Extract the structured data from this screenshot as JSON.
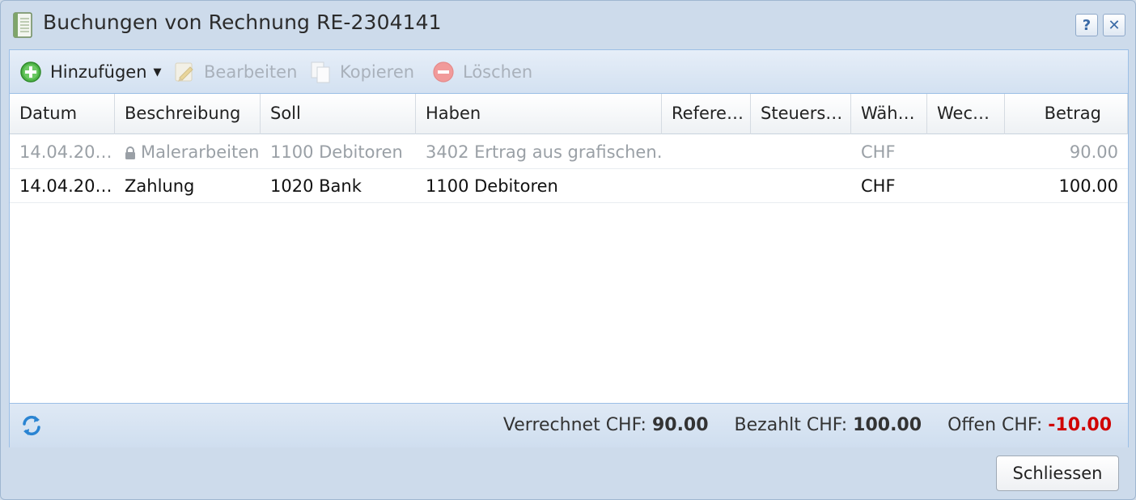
{
  "window": {
    "title": "Buchungen von Rechnung RE-2304141",
    "help_label": "?",
    "close_label": "✕"
  },
  "toolbar": {
    "add_label": "Hinzufügen",
    "edit_label": "Bearbeiten",
    "copy_label": "Kopieren",
    "delete_label": "Löschen"
  },
  "grid": {
    "columns": [
      "Datum",
      "Beschreibung",
      "Soll",
      "Haben",
      "Refere…",
      "Steuers…",
      "Wäh…",
      "Wec…",
      "Betrag"
    ],
    "rows": [
      {
        "locked": true,
        "datum": "14.04.20…",
        "beschreibung": "Malerarbeiten",
        "soll": "1100 Debitoren",
        "haben": "3402 Ertrag aus grafischen…",
        "referenz": "",
        "steuersatz": "",
        "waehrung": "CHF",
        "wechselkurs": "",
        "betrag": "90.00"
      },
      {
        "locked": false,
        "datum": "14.04.20…",
        "beschreibung": "Zahlung",
        "soll": "1020 Bank",
        "haben": "1100 Debitoren",
        "referenz": "",
        "steuersatz": "",
        "waehrung": "CHF",
        "wechselkurs": "",
        "betrag": "100.00"
      }
    ]
  },
  "summary": {
    "verrechnet_label": "Verrechnet CHF:",
    "verrechnet_value": "90.00",
    "bezahlt_label": "Bezahlt CHF:",
    "bezahlt_value": "100.00",
    "offen_label": "Offen CHF:",
    "offen_value": "-10.00"
  },
  "buttons": {
    "close_label": "Schliessen"
  },
  "colors": {
    "negative": "#d00000",
    "accent": "#3a6aa6"
  }
}
